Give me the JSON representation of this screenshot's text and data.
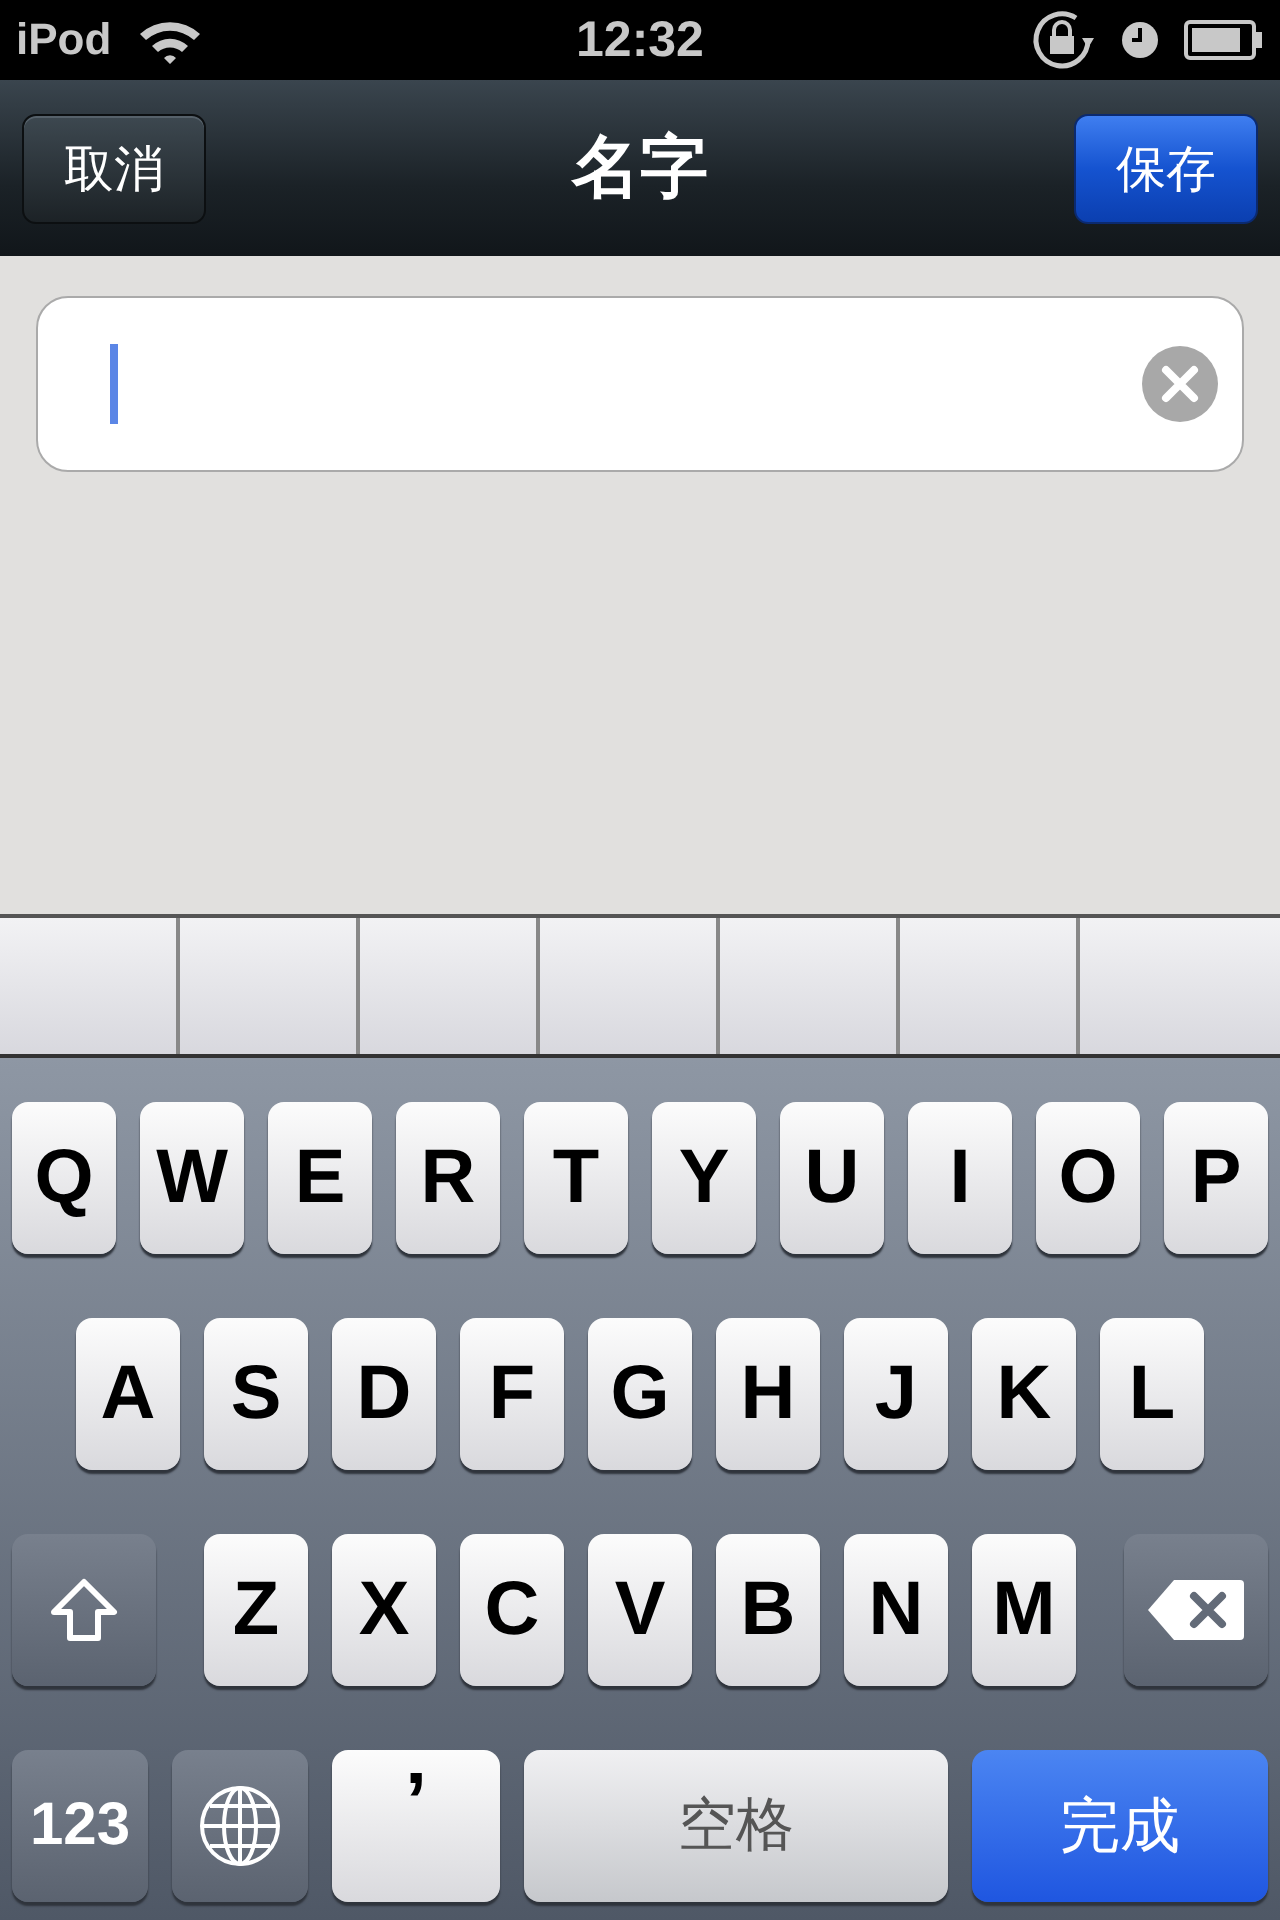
{
  "status_bar": {
    "carrier": "iPod",
    "time": "12:32"
  },
  "nav_bar": {
    "cancel": "取消",
    "title": "名字",
    "save": "保存"
  },
  "name_field": {
    "focused": true
  },
  "keyboard": {
    "top_row": [
      {
        "kind": "letter",
        "label": "Q"
      },
      {
        "kind": "letter",
        "label": "W"
      },
      {
        "kind": "letter",
        "label": "E"
      },
      {
        "kind": "letter",
        "label": "R"
      },
      {
        "kind": "letter",
        "label": "T"
      },
      {
        "kind": "letter",
        "label": "Y"
      },
      {
        "kind": "letter",
        "label": "U"
      },
      {
        "kind": "letter",
        "label": "I"
      },
      {
        "kind": "letter",
        "label": "O"
      },
      {
        "kind": "letter",
        "label": "P"
      }
    ],
    "home_row": [
      {
        "kind": "letter",
        "label": "A"
      },
      {
        "kind": "letter",
        "label": "S"
      },
      {
        "kind": "letter",
        "label": "D"
      },
      {
        "kind": "letter",
        "label": "F"
      },
      {
        "kind": "letter",
        "label": "G"
      },
      {
        "kind": "letter",
        "label": "H"
      },
      {
        "kind": "letter",
        "label": "J"
      },
      {
        "kind": "letter",
        "label": "K"
      },
      {
        "kind": "letter",
        "label": "L"
      }
    ],
    "lower_row": [
      {
        "kind": "shift"
      },
      {
        "kind": "letter",
        "label": "Z"
      },
      {
        "kind": "letter",
        "label": "X"
      },
      {
        "kind": "letter",
        "label": "C"
      },
      {
        "kind": "letter",
        "label": "V"
      },
      {
        "kind": "letter",
        "label": "B"
      },
      {
        "kind": "letter",
        "label": "N"
      },
      {
        "kind": "letter",
        "label": "M"
      },
      {
        "kind": "delete"
      }
    ],
    "bottom_row": [
      {
        "kind": "numbers",
        "label": "123"
      },
      {
        "kind": "globe"
      },
      {
        "kind": "comma",
        "label": "’"
      },
      {
        "kind": "space",
        "label": "空格"
      },
      {
        "kind": "done",
        "label": "完成"
      }
    ]
  }
}
